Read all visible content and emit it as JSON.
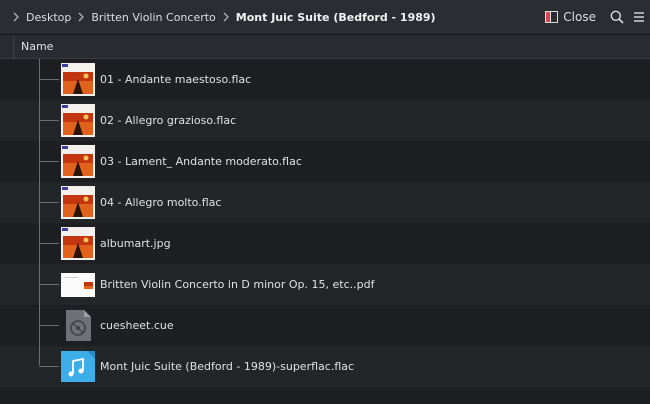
{
  "breadcrumb": {
    "items": [
      "Desktop",
      "Britten Violin Concerto"
    ],
    "current": "Mont Juic Suite (Bedford - 1989)"
  },
  "toolbar": {
    "close_label": "Close"
  },
  "header": {
    "name_column": "Name"
  },
  "files": [
    {
      "name": "01 - Andante maestoso.flac",
      "icon": "album-art-thumbnail"
    },
    {
      "name": "02 - Allegro grazioso.flac",
      "icon": "album-art-thumbnail"
    },
    {
      "name": "03 - Lament_ Andante moderato.flac",
      "icon": "album-art-thumbnail"
    },
    {
      "name": "04 - Allegro molto.flac",
      "icon": "album-art-thumbnail"
    },
    {
      "name": "albumart.jpg",
      "icon": "album-art-thumbnail"
    },
    {
      "name": "Britten Violin Concerto in D minor Op. 15, etc..pdf",
      "icon": "pdf-thumbnail"
    },
    {
      "name": "cuesheet.cue",
      "icon": "cue-file-icon"
    },
    {
      "name": "Mont Juic Suite (Bedford - 1989)-superflac.flac",
      "icon": "audio-file-icon"
    }
  ],
  "colors": {
    "background": "#1e2023",
    "toolbar": "#2a2e32",
    "row_alt": "#232629",
    "audio_icon": "#3daee9"
  }
}
